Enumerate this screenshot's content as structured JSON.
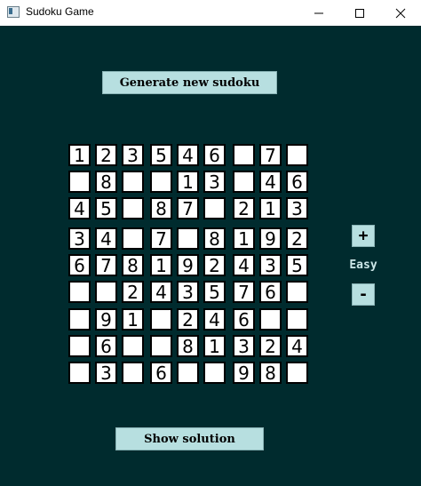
{
  "window": {
    "title": "Sudoku Game",
    "controls": {
      "minimize": "minimize",
      "maximize": "maximize",
      "close": "close"
    }
  },
  "colors": {
    "background": "#002b2e",
    "button": "#b7dfe0",
    "cell": "#ffffff",
    "label": "#cde7e8"
  },
  "buttons": {
    "generate_label": "Generate new sudoku",
    "show_solution_label": "Show solution",
    "increase_label": "+",
    "decrease_label": "-"
  },
  "difficulty": "Easy",
  "board": [
    [
      "1",
      "2",
      "3",
      "5",
      "4",
      "6",
      "",
      "7",
      ""
    ],
    [
      "",
      "8",
      "",
      "",
      "1",
      "3",
      "",
      "4",
      "6"
    ],
    [
      "4",
      "5",
      "",
      "8",
      "7",
      "",
      "2",
      "1",
      "3"
    ],
    [
      "3",
      "4",
      "",
      "7",
      "",
      "8",
      "1",
      "9",
      "2"
    ],
    [
      "6",
      "7",
      "8",
      "1",
      "9",
      "2",
      "4",
      "3",
      "5"
    ],
    [
      "",
      "",
      "2",
      "4",
      "3",
      "5",
      "7",
      "6",
      ""
    ],
    [
      "",
      "9",
      "1",
      "",
      "2",
      "4",
      "6",
      "",
      ""
    ],
    [
      "",
      "6",
      "",
      "",
      "8",
      "1",
      "3",
      "2",
      "4"
    ],
    [
      "",
      "3",
      "",
      "6",
      "",
      "",
      "9",
      "8",
      ""
    ]
  ]
}
